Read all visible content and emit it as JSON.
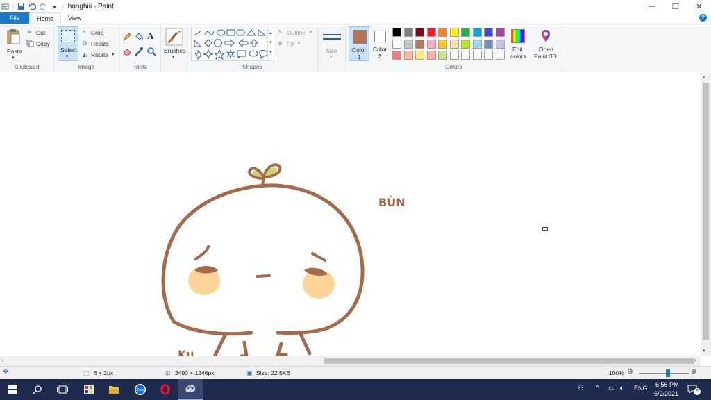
{
  "window": {
    "title": "honghiii - Paint",
    "minimize": "—",
    "restore": "❐",
    "close": "✕"
  },
  "menu": {
    "file": "File",
    "home": "Home",
    "view": "View",
    "help": "?"
  },
  "clipboard": {
    "paste": "Paste",
    "cut": "Cut",
    "copy": "Copy",
    "label": "Clipboard"
  },
  "image": {
    "select": "Select",
    "crop": "Crop",
    "resize": "Resize",
    "rotate": "Rotate",
    "label": "Image"
  },
  "tools": {
    "label": "Tools",
    "text_tool": "A"
  },
  "brushes": {
    "label": "Brushes"
  },
  "shapes": {
    "outline": "Outline",
    "fill": "Fill",
    "label": "Shapes"
  },
  "size": {
    "label": "Size"
  },
  "colors": {
    "color1": "Color",
    "color1_num": "1",
    "color2": "Color",
    "color2_num": "2",
    "edit_colors": "Edit",
    "edit_colors2": "colors",
    "open_paint3d": "Open",
    "open_paint3d2": "Paint 3D",
    "label": "Colors",
    "color1_value": "#b5734f",
    "color2_value": "#ffffff",
    "palette_row1": [
      "#000000",
      "#7f7f7f",
      "#880015",
      "#ed1c24",
      "#ff7f27",
      "#fff200",
      "#22b14c",
      "#00a2e8",
      "#3f48cc",
      "#a349a4"
    ],
    "palette_row2": [
      "#ffffff",
      "#c3c3c3",
      "#b97a57",
      "#ffaec9",
      "#ffc90e",
      "#efe4b0",
      "#b5e61d",
      "#99d9ea",
      "#7092be",
      "#c8bfe7"
    ],
    "palette_row3": [
      "#f07b7b",
      "#fdb99a",
      "#ffef6e",
      "#fdb3a0",
      "#c8e88f",
      "#ffffff",
      "#ffffff",
      "#ffffff",
      "#ffffff",
      "#ffffff"
    ]
  },
  "drawing": {
    "name_right": "BÙN",
    "name_left": "Ku",
    "stroke": "#a56a4a",
    "cheek": "#ffd49a",
    "leaf": "#c6d46a"
  },
  "status": {
    "selection": "6 × 2px",
    "dimensions": "2490 × 1246px",
    "size": "Size: 22.5KB",
    "zoom": "100%",
    "zoom_level": 0.58
  },
  "taskbar": {
    "time": "6:56 PM",
    "date": "6/2/2021",
    "lang": "ENG",
    "notif": "2"
  }
}
